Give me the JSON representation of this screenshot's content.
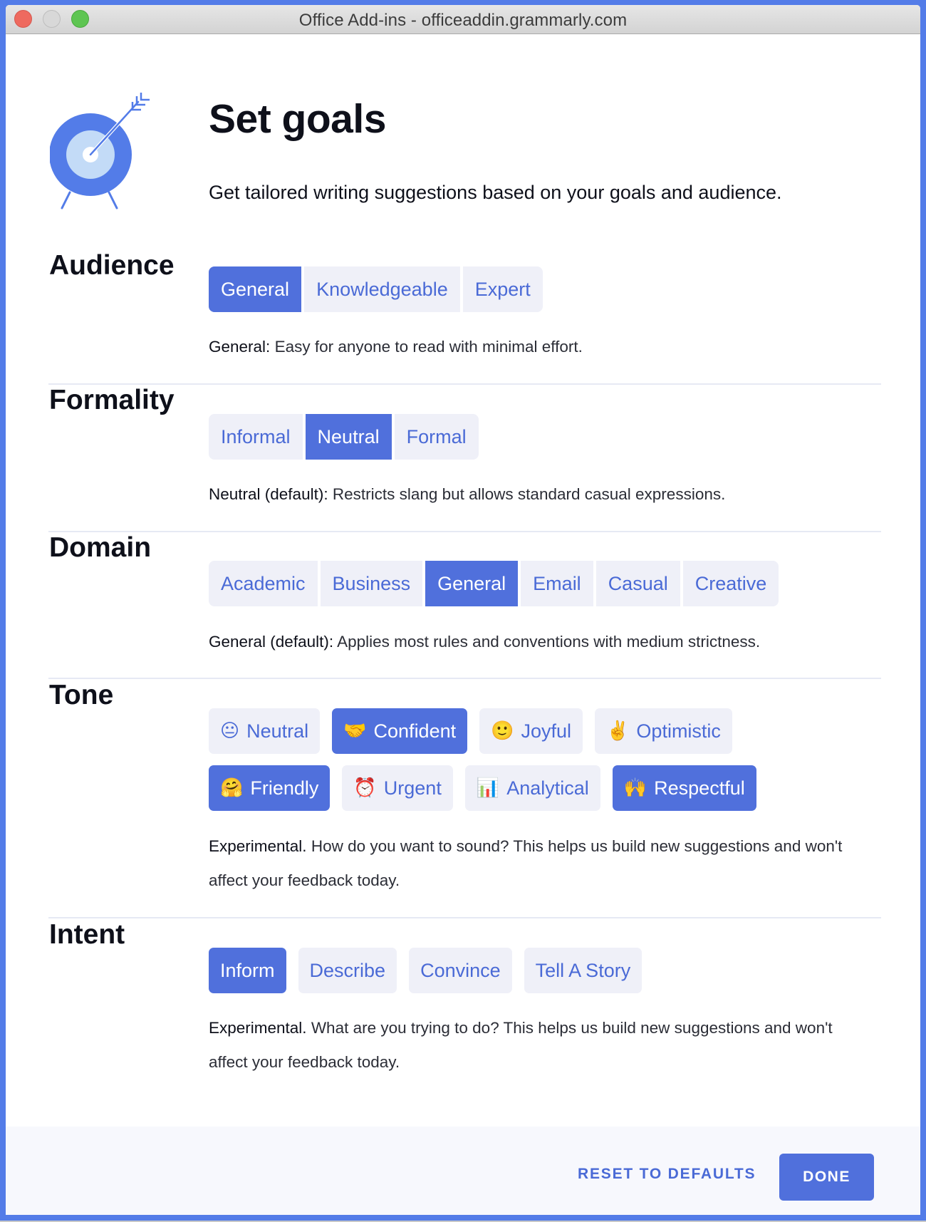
{
  "window": {
    "title": "Office Add-ins - officeaddin.grammarly.com"
  },
  "header": {
    "logo_icon": "target-with-arrow-icon",
    "title": "Set goals",
    "subtitle": "Get tailored writing suggestions based on your goals and audience."
  },
  "colors": {
    "accent": "#5070dc",
    "accent_text": "#4a6ad6",
    "unselected_bg": "#eff0f8",
    "window_border": "#537ce8",
    "footer_bg": "#f7f8fd"
  },
  "audience": {
    "label": "Audience",
    "options": [
      {
        "label": "General",
        "selected": true
      },
      {
        "label": "Knowledgeable",
        "selected": false
      },
      {
        "label": "Expert",
        "selected": false
      }
    ],
    "desc_strong": "General:",
    "desc_text": " Easy for anyone to read with minimal effort."
  },
  "formality": {
    "label": "Formality",
    "options": [
      {
        "label": "Informal",
        "selected": false
      },
      {
        "label": "Neutral",
        "selected": true
      },
      {
        "label": "Formal",
        "selected": false
      }
    ],
    "desc_strong": "Neutral (default):",
    "desc_text": " Restricts slang but allows standard casual expressions."
  },
  "domain": {
    "label": "Domain",
    "options": [
      {
        "label": "Academic",
        "selected": false
      },
      {
        "label": "Business",
        "selected": false
      },
      {
        "label": "General",
        "selected": true
      },
      {
        "label": "Email",
        "selected": false
      },
      {
        "label": "Casual",
        "selected": false
      },
      {
        "label": "Creative",
        "selected": false
      }
    ],
    "desc_strong": "General (default):",
    "desc_text": " Applies most rules and conventions with medium strictness."
  },
  "tone": {
    "label": "Tone",
    "options": [
      {
        "label": "Neutral",
        "emoji": "😐",
        "icon": "neutral-face-icon",
        "selected": false
      },
      {
        "label": "Confident",
        "emoji": "🤝",
        "icon": "handshake-icon",
        "selected": true
      },
      {
        "label": "Joyful",
        "emoji": "🙂",
        "icon": "smiling-face-icon",
        "selected": false
      },
      {
        "label": "Optimistic",
        "emoji": "✌️",
        "icon": "victory-hand-icon",
        "selected": false
      },
      {
        "label": "Friendly",
        "emoji": "🤗",
        "icon": "hugging-face-icon",
        "selected": true
      },
      {
        "label": "Urgent",
        "emoji": "⏰",
        "icon": "alarm-clock-icon",
        "selected": false
      },
      {
        "label": "Analytical",
        "emoji": "📊",
        "icon": "bar-chart-icon",
        "selected": false
      },
      {
        "label": "Respectful",
        "emoji": "🙌",
        "icon": "raising-hands-icon",
        "selected": true
      }
    ],
    "desc_strong": "Experimental.",
    "desc_text": " How do you want to sound? This helps us build new suggestions and won't affect your feedback today."
  },
  "intent": {
    "label": "Intent",
    "options": [
      {
        "label": "Inform",
        "selected": true
      },
      {
        "label": "Describe",
        "selected": false
      },
      {
        "label": "Convince",
        "selected": false
      },
      {
        "label": "Tell A Story",
        "selected": false
      }
    ],
    "desc_strong": "Experimental.",
    "desc_text": " What are you trying to do? This helps us build new suggestions and won't affect your feedback today."
  },
  "footer": {
    "reset_label": "RESET TO DEFAULTS",
    "done_label": "DONE"
  }
}
